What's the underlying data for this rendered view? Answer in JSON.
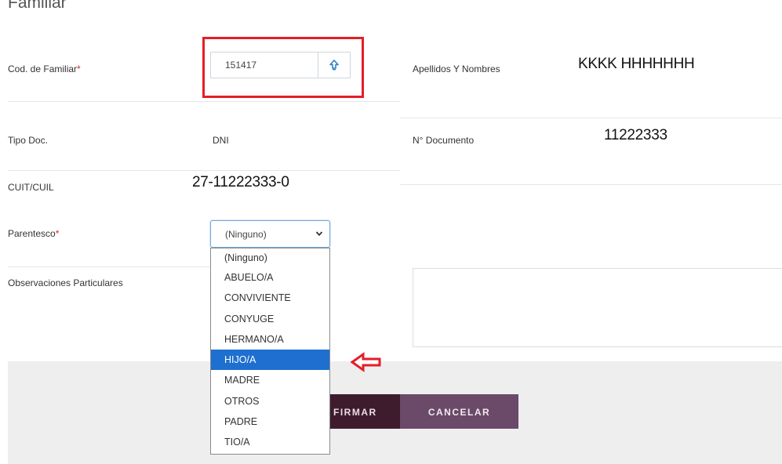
{
  "section": {
    "title": "Familiar"
  },
  "fields": {
    "cod_familiar": {
      "label": "Cod. de Familiar",
      "required_mark": "*",
      "value": "151417"
    },
    "apellidos_nombres": {
      "label": "Apellidos Y Nombres",
      "value": "KKKK HHHHHHH"
    },
    "tipo_doc": {
      "label": "Tipo Doc.",
      "value": "DNI"
    },
    "nro_documento": {
      "label": "N° Documento",
      "value": "11222333"
    },
    "cuit_cuil": {
      "label": "CUIT/CUIL",
      "value": "27-11222333-0"
    },
    "parentesco": {
      "label": "Parentesco",
      "required_mark": "*",
      "selected": "(Ninguno)",
      "options": [
        "(Ninguno)",
        "ABUELO/A",
        "CONVIVIENTE",
        "CONYUGE",
        "HERMANO/A",
        "HIJO/A",
        "MADRE",
        "OTROS",
        "PADRE",
        "TIO/A"
      ],
      "highlighted_option": "HIJO/A"
    },
    "observaciones": {
      "label": "Observaciones Particulares",
      "value": ""
    }
  },
  "buttons": {
    "firmar": "FIRMAR",
    "cancelar": "CANCELAR"
  },
  "icons": {
    "lookup": "up-arrow-icon",
    "select_chevron": "chevron-down-icon",
    "indicator": "left-arrow-icon"
  },
  "colors": {
    "highlight_box": "#e41e26",
    "selected_option": "#1e6fd0",
    "firmar_button": "#3e1c2e",
    "cancelar_button": "#6a4a68",
    "required_mark": "#d9232a"
  }
}
